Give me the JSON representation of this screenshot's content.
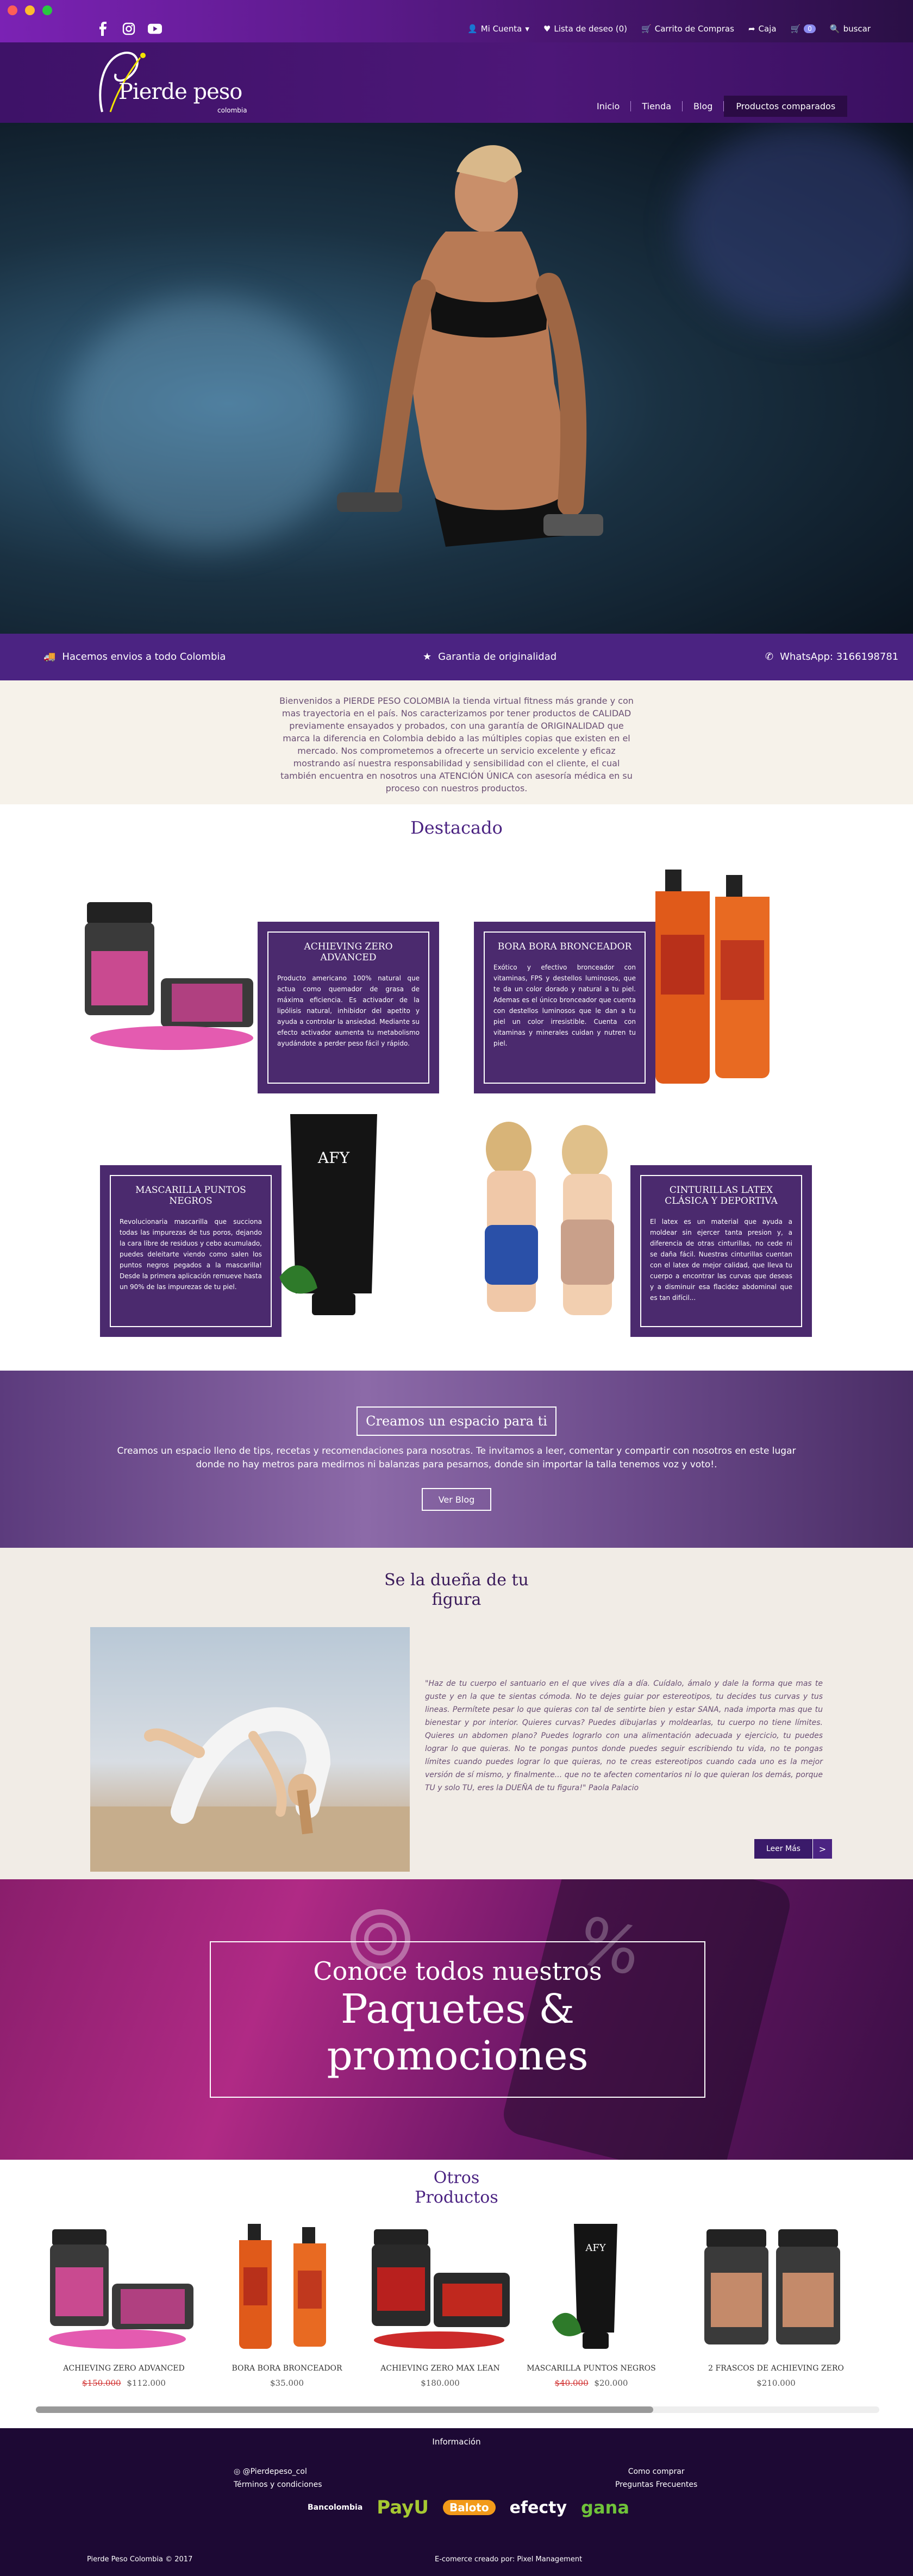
{
  "browser": {
    "dot_colors": [
      "#ff5f57",
      "#febc2e",
      "#28c840"
    ]
  },
  "social": [
    {
      "name": "facebook-icon",
      "glyph": "f"
    },
    {
      "name": "instagram-icon",
      "glyph": "◎"
    },
    {
      "name": "youtube-icon",
      "glyph": "▶"
    }
  ],
  "topnav": {
    "account": "Mi Cuenta",
    "wishlist": "Lista de deseo (0)",
    "cart": "Carrito de Compras",
    "checkout": "Caja",
    "cart_count": "0",
    "search": "buscar"
  },
  "logo": {
    "text": "Pierde peso",
    "sub": "colombia"
  },
  "mainnav": [
    "Inicio",
    "Tienda",
    "Blog",
    "Productos comparados"
  ],
  "strip": {
    "shipping": "Hacemos envios a todo Colombia",
    "original": "Garantia de originalidad",
    "whatsapp": "WhatsApp: 3166198781"
  },
  "intro": "Bienvenidos a PIERDE PESO COLOMBIA la tienda virtual fitness más grande y con mas trayectoria en el país. Nos caracterizamos por tener productos de CALIDAD previamente ensayados y probados, con una garantía de ORIGINALIDAD que marca la diferencia en Colombia debido a las múltiples copias que existen en el mercado. Nos comprometemos a ofrecerte un servicio excelente y eficaz mostrando así nuestra responsabilidad y sensibilidad con el cliente, el cual también encuentra en nosotros una ATENCIÓN ÚNICA con asesoría médica en su proceso con nuestros productos.",
  "destacado": {
    "title": "Destacado",
    "cards": [
      {
        "title": "ACHIEVING ZERO ADVANCED",
        "text": "Producto americano 100% natural que actua como quemador de grasa de máxima eficiencia. Es activador de la lipólisis natural, inhibidor del apetito y ayuda a controlar la ansiedad. Mediante su efecto activador aumenta tu metabolismo ayudándote a perder peso fácil y rápido."
      },
      {
        "title": "BORA BORA BRONCEADOR",
        "text": "Exótico y efectivo bronceador con vitaminas, FPS y destellos luminosos, que te da un color dorado y natural a tu piel. Ademas es el único bronceador que cuenta con destellos luminosos que le dan a tu piel un color irresistible. Cuenta con vitaminas y minerales cuidan y nutren tu piel."
      },
      {
        "title": "MASCARILLA PUNTOS NEGROS",
        "text": "Revolucionaria mascarilla que succiona todas las impurezas de tus poros, dejando la cara libre de residuos y cebo acumulado, puedes deleitarte viendo como salen los puntos negros pegados a la mascarilla! Desde la primera aplicación remueve hasta un 90% de las impurezas de tu piel."
      },
      {
        "title": "CINTURILLAS LATEX CLÁSICA Y DEPORTIVA",
        "text": "El latex es un material que ayuda a moldear sin ejercer tanta presion y, a diferencia de otras cinturillas, no cede ni se daña fácil. Nuestras cinturillas cuentan con el latex de mejor calidad, que lleva tu cuerpo a encontrar las curvas que deseas y a disminuir esa flacidez abdominal que es tan difícil..."
      }
    ]
  },
  "blog": {
    "title": "Creamos un espacio para ti",
    "text": "Creamos un espacio lleno de tips, recetas y recomendaciones para nosotras. Te invitamos a leer, comentar y compartir con nosotros en este lugar donde no hay metros para medirnos ni balanzas para pesarnos, donde sin importar la talla tenemos voz y voto!.",
    "button": "Ver Blog"
  },
  "figura": {
    "title_1": "Se la dueña de tu",
    "title_2": "figura",
    "quote": "\"Haz de tu cuerpo el santuario en el que vives día a día. Cuídalo, ámalo y dale la forma que mas te guste y en la que te sientas cómoda. No te dejes guiar por estereotipos, tu decides tus curvas y tus lineas. Permítete pesar lo que quieras con tal de sentirte bien y estar SANA, nada importa mas que tu bienestar y por interior. Quieres curvas? Puedes dibujarlas y moldearlas, tu cuerpo no tiene límites. Quieres un abdomen plano? Puedes lograrlo con una alimentación adecuada y ejercicio, tu puedes lograr lo que quieras. No te pongas puntos donde puedes seguir escribiendo tu vida, no te pongas límites cuando puedes lograr lo que quieras, no te creas estereotipos cuando cada uno es la mejor versión de sí mismo, y finalmente... que no te afecten comentarios ni lo que quieran los demás, porque TU y solo TU, eres la DUEÑA de tu figura!\" Paola Palacio",
    "more": "Leer Más",
    "arrow": ">"
  },
  "promo": {
    "line1": "Conoce todos nuestros",
    "line2": "Paquetes &",
    "line3": "promociones"
  },
  "otros": {
    "title_1": "Otros",
    "title_2": "Productos",
    "items": [
      {
        "name": "ACHIEVING ZERO ADVANCED",
        "old": "$150.000",
        "price": "$112.000"
      },
      {
        "name": "BORA BORA BRONCEADOR",
        "old": "",
        "price": "$35.000"
      },
      {
        "name": "ACHIEVING ZERO MAX LEAN",
        "old": "",
        "price": "$180.000"
      },
      {
        "name": "MASCARILLA PUNTOS NEGROS",
        "old": "$40.000",
        "price": "$20.000"
      },
      {
        "name": "2 FRASCOS DE ACHIEVING ZERO",
        "old": "",
        "price": "$210.000"
      }
    ]
  },
  "footer": {
    "info": "Información",
    "instagram": "@Pierdepeso_col",
    "terms": "Términos y condiciones",
    "buy": "Como comprar",
    "faq": "Preguntas Frecuentes",
    "payments": [
      "Bancolombia",
      "PayU",
      "Baloto",
      "efecty",
      "gana"
    ],
    "copy": "Pierde Peso Colombia © 2017",
    "credit": "E-comerce creado por: Pixel Management"
  }
}
